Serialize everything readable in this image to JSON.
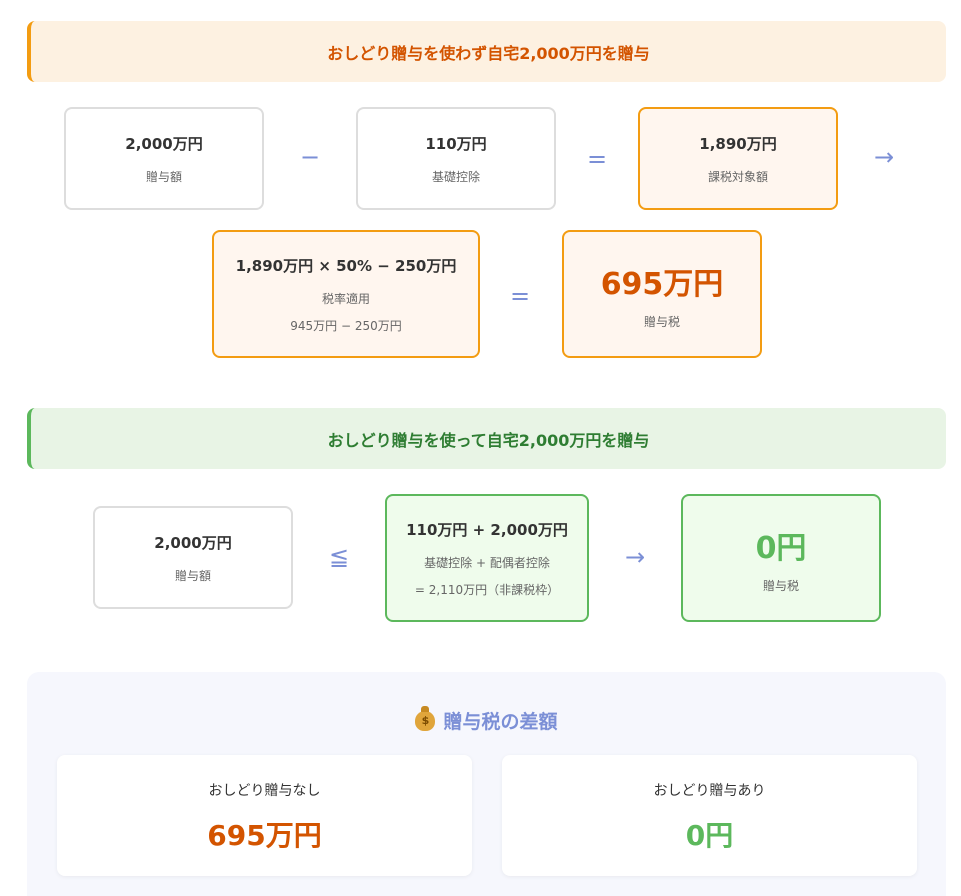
{
  "without": {
    "title": "おしどり贈与を使わず自宅2,000万円を贈与",
    "gift": {
      "amount": "2,000万円",
      "label": "贈与額"
    },
    "op_minus": "−",
    "deduction": {
      "amount": "110万円",
      "label": "基礎控除"
    },
    "op_equals1": "=",
    "taxable": {
      "amount": "1,890万円",
      "label": "課税対象額"
    },
    "arrow": "→",
    "formula": {
      "main": "1,890万円 × 50% − 250万円",
      "label": "税率適用",
      "detail": "945万円 − 250万円"
    },
    "op_equals2": "=",
    "tax": {
      "amount": "695万円",
      "label": "贈与税"
    }
  },
  "with": {
    "title": "おしどり贈与を使って自宅2,000万円を贈与",
    "gift": {
      "amount": "2,000万円",
      "label": "贈与額"
    },
    "op_leq": "≦",
    "deduction": {
      "amount": "110万円 + 2,000万円",
      "label": "基礎控除 + 配偶者控除",
      "detail": "= 2,110万円（非課税枠）"
    },
    "arrow": "→",
    "tax": {
      "amount": "0円",
      "label": "贈与税"
    }
  },
  "summary": {
    "icon": "money-bag-icon",
    "title": "贈与税の差額",
    "without_label": "おしどり贈与なし",
    "without_value": "695万円",
    "with_label": "おしどり贈与あり",
    "with_value": "0円"
  },
  "colors": {
    "orange_accent": "#f39c12",
    "orange_text": "#d35400",
    "green_accent": "#5cb85c",
    "operator": "#7b8fd6"
  }
}
